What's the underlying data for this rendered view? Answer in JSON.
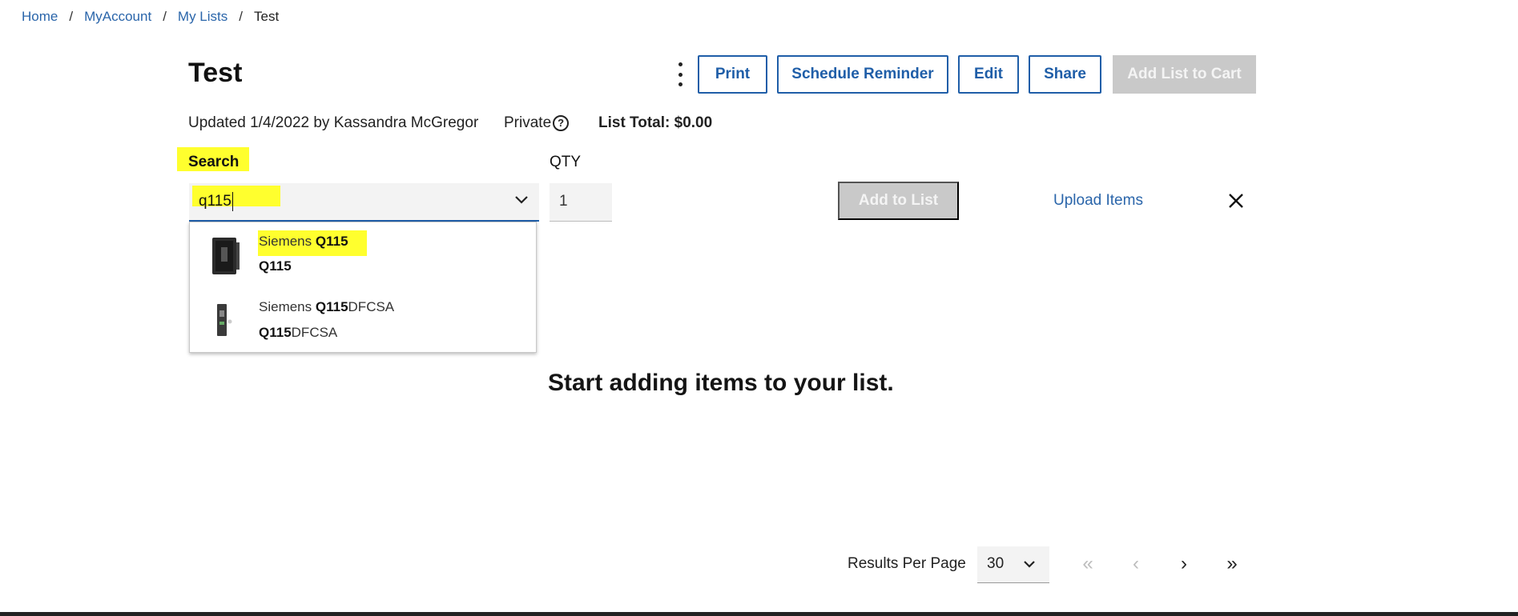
{
  "breadcrumb": {
    "items": [
      "Home",
      "MyAccount",
      "My Lists"
    ],
    "current": "Test",
    "separator": "/"
  },
  "page": {
    "title": "Test"
  },
  "toolbar": {
    "more_icon": "kebab-vertical-icon",
    "print": "Print",
    "schedule_reminder": "Schedule Reminder",
    "edit": "Edit",
    "share": "Share",
    "add_list_to_cart": "Add List to Cart"
  },
  "meta": {
    "updated": "Updated 1/4/2022 by Kassandra McGregor",
    "visibility": "Private",
    "help_glyph": "?",
    "list_total": "List Total: $0.00"
  },
  "search": {
    "label": "Search",
    "value": "q115"
  },
  "qty": {
    "label": "QTY",
    "value": "1"
  },
  "actions": {
    "add_to_list": "Add to List",
    "upload_items": "Upload Items"
  },
  "suggestions": [
    {
      "brand": "Siemens",
      "match": "Q115",
      "rest": "",
      "sku_match": "Q115",
      "sku_rest": ""
    },
    {
      "brand": "Siemens",
      "match": "Q115",
      "rest": "DFCSA",
      "sku_match": "Q115",
      "sku_rest": "DFCSA"
    }
  ],
  "empty_state": {
    "message": "Start adding items to your list."
  },
  "pagination": {
    "results_per_page_label": "Results Per Page",
    "results_per_page_value": "30",
    "first": "«",
    "prev": "‹",
    "next": "›",
    "last": "»"
  },
  "colors": {
    "accent": "#1f5ea8",
    "highlight": "#ffff2e",
    "disabled": "#c9c9c9"
  }
}
